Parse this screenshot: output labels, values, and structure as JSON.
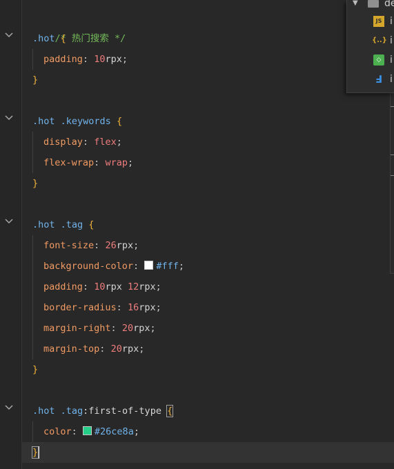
{
  "code": {
    "comment": "/* 热门搜索 */",
    "hot_selector": ".hot",
    "keywords_selector": ".hot .keywords",
    "tag_selector": ".hot .tag",
    "first_tag_selector_base": ".hot .tag",
    "first_tag_pseudo": ":first-of-type",
    "open_brace": "{",
    "close_brace": "}",
    "hot_rules": [
      {
        "prop": "padding",
        "num": "10",
        "unit": "rpx"
      }
    ],
    "keywords_rules": [
      {
        "prop": "display",
        "val": "flex"
      },
      {
        "prop": "flex-wrap",
        "val": "wrap"
      }
    ],
    "tag_rules": [
      {
        "prop": "font-size",
        "num": "26",
        "unit": "rpx"
      },
      {
        "prop": "background-color",
        "hex": "#fff"
      },
      {
        "prop": "padding",
        "num": "10",
        "unit": "rpx",
        "num2": "12",
        "unit2": "rpx"
      },
      {
        "prop": "border-radius",
        "num": "16",
        "unit": "rpx"
      },
      {
        "prop": "margin-right",
        "num": "20",
        "unit": "rpx"
      },
      {
        "prop": "margin-top",
        "num": "20",
        "unit": "rpx"
      }
    ],
    "first_rules": [
      {
        "prop": "color",
        "hex": "#26ce8a"
      }
    ],
    "colon": ":",
    "semicolon": ";"
  },
  "file_tree": {
    "folder_name": "de",
    "items": [
      {
        "icon": "js-file-icon",
        "label": "JS",
        "name": "i"
      },
      {
        "icon": "json-file-icon",
        "label": "{..}",
        "name": "i"
      },
      {
        "icon": "html-file-icon",
        "label": "",
        "name": "i"
      },
      {
        "icon": "css-file-icon",
        "label": "",
        "name": "i"
      }
    ]
  },
  "colors": {
    "swatch_white": "#ffffff",
    "swatch_green": "#26ce8a"
  }
}
